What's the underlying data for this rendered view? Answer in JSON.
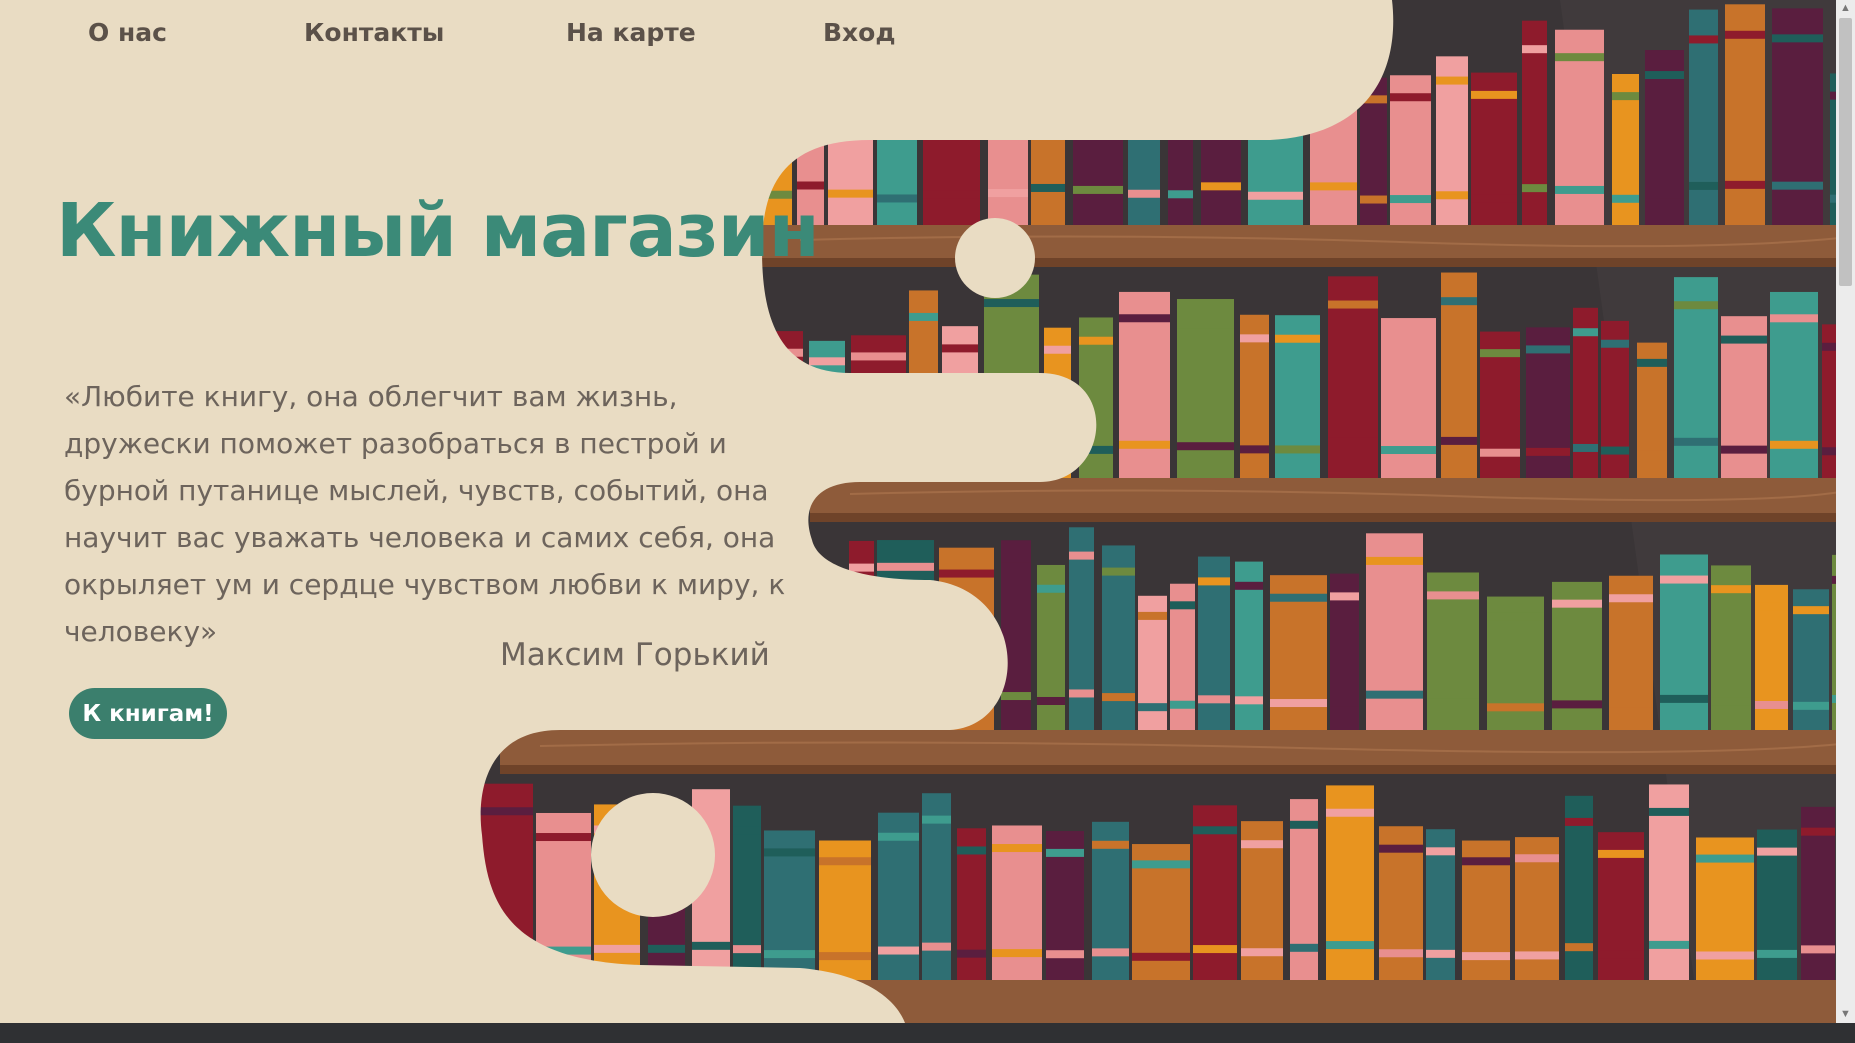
{
  "nav": {
    "items": [
      {
        "label": "О нас"
      },
      {
        "label": "Контакты"
      },
      {
        "label": "На карте"
      },
      {
        "label": "Вход"
      }
    ]
  },
  "hero": {
    "title": "Книжный магазин",
    "quote": "«Любите книгу, она облегчит вам  жизнь, дружески поможет разобраться в пестрой и бурной путанице мыслей,  чувств,  событий, она  научит вас уважать человека и  самих себя,  она окрыляет  ум и сердце чувством любви к миру, к человеку»",
    "author": "Максим Горький",
    "button_label": "К книгам!"
  },
  "colors": {
    "background": "#e9dcc3",
    "accent": "#3b8a78",
    "button": "#3b7f6d",
    "text": "#6d645c",
    "shelf_wall": "#3a3537",
    "wood": "#8e5b3a"
  },
  "scrollbar": {
    "up_icon": "scroll-up-arrow-icon",
    "down_icon": "scroll-down-arrow-icon"
  }
}
